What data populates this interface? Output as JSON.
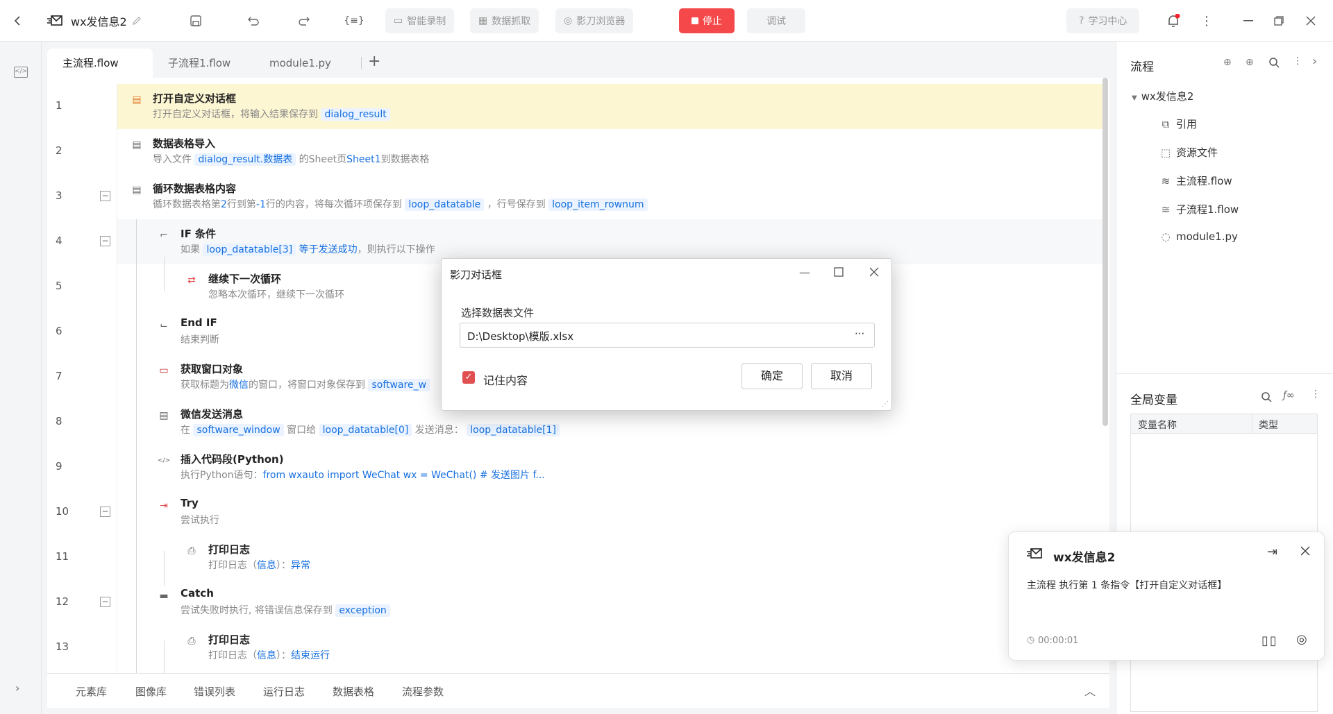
{
  "topbar": {
    "title": "wx发信息2",
    "record_label": "智能录制",
    "scrape_label": "数据抓取",
    "browser_label": "影刀浏览器",
    "stop_label": "停止",
    "debug_label": "调试",
    "learn_label": "学习中心"
  },
  "tabs": [
    {
      "label": "主流程.flow"
    },
    {
      "label": "子流程1.flow"
    },
    {
      "label": "module1.py"
    }
  ],
  "steps": [
    {
      "no": "1",
      "title": "打开自定义对话框",
      "d1": "打开自定义对话框，将输入结果保存到",
      "v1": "dialog_result"
    },
    {
      "no": "2",
      "title": "数据表格导入",
      "d1": "导入文件",
      "v1": "dialog_result.数据表",
      "d2": "的Sheet页",
      "l2": "Sheet1",
      "d3": "到数据表格"
    },
    {
      "no": "3",
      "title": "循环数据表格内容",
      "d1": "循环数据表格第",
      "l1": "2",
      "d2": "行到第",
      "l2": "-1",
      "d3": "行的内容，将每次循环项保存到",
      "v1": "loop_datatable",
      "d4": "，行号保存到",
      "v2": "loop_item_rownum"
    },
    {
      "no": "4",
      "title": "IF 条件",
      "d1": "如果",
      "v1": "loop_datatable[3]",
      "l1": "等于",
      "l2": "发送成功",
      "d2": "，则执行以下操作"
    },
    {
      "no": "5",
      "title": "继续下一次循环",
      "d1": "忽略本次循环，继续下一次循环"
    },
    {
      "no": "6",
      "title": "End IF",
      "d1": "结束判断"
    },
    {
      "no": "7",
      "title": "获取窗口对象",
      "d1": "获取标题为",
      "l1": "微信",
      "d2": "的窗口，将窗口对象保存到",
      "v1": "software_w"
    },
    {
      "no": "8",
      "title": "微信发送消息",
      "d1": "在",
      "v1": "software_window",
      "d2": "窗口给",
      "v2": "loop_datatable[0]",
      "d3": "发送消息：",
      "v3": "loop_datatable[1]"
    },
    {
      "no": "9",
      "title": "插入代码段(Python)",
      "d1": "执行Python语句：",
      "l1": "from wxauto import WeChat  wx = WeChat()  # 发送图片 f..."
    },
    {
      "no": "10",
      "title": "Try",
      "d1": "尝试执行"
    },
    {
      "no": "11",
      "title": "打印日志",
      "d1": "打印日志（",
      "l1": "信息",
      "d2": "）：",
      "l2": "异常"
    },
    {
      "no": "12",
      "title": "Catch",
      "d1": "尝试失败时执行, 将错误信息保存到",
      "v1": "exception"
    },
    {
      "no": "13",
      "title": "打印日志",
      "d1": "打印日志（",
      "l1": "信息",
      "d2": "）：",
      "l2": "结束运行"
    }
  ],
  "bottom_tabs": [
    "元素库",
    "图像库",
    "错误列表",
    "运行日志",
    "数据表格",
    "流程参数"
  ],
  "right_panel": {
    "flow_title": "流程",
    "tree_root": "wx发信息2",
    "tree_items": [
      "引用",
      "资源文件",
      "主流程.flow",
      "子流程1.flow",
      "module1.py"
    ],
    "globals_title": "全局变量",
    "col_name": "变量名称",
    "col_type": "类型"
  },
  "dialog": {
    "title": "影刀对话框",
    "label": "选择数据表文件",
    "file_value": "D:\\Desktop\\模版.xlsx",
    "browse": "···",
    "remember": "记住内容",
    "ok": "确定",
    "cancel": "取消"
  },
  "notify": {
    "title": "wx发信息2",
    "message": "主流程 执行第 1 条指令【打开自定义对话框】",
    "time": "00:00:01"
  },
  "colors": {
    "stop": "#f5484a",
    "accent": "#1670e0",
    "highlight_row": "#fdf6d3"
  }
}
